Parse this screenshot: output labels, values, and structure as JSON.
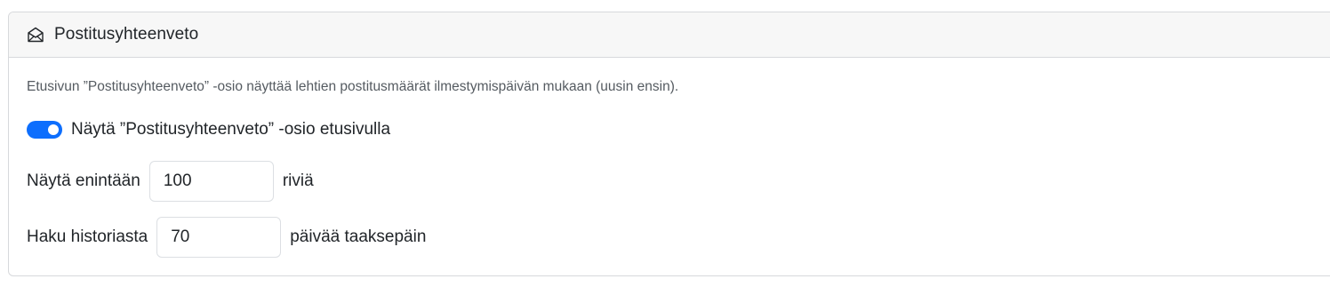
{
  "card": {
    "title": "Postitusyhteenveto",
    "icon": "envelope-open-icon"
  },
  "description": "Etusivun ”Postitusyhteenveto” -osio näyttää lehtien postitusmäärät ilmestymispäivän mukaan (uusin ensin).",
  "toggle": {
    "label": "Näytä ”Postitusyhteenveto” -osio etusivulla",
    "checked": true,
    "color": "#0d6efd"
  },
  "max_rows": {
    "label": "Näytä enintään",
    "value": "100",
    "suffix": "riviä"
  },
  "history": {
    "label": "Haku historiasta",
    "value": "70",
    "suffix": "päivää taaksepäin"
  }
}
